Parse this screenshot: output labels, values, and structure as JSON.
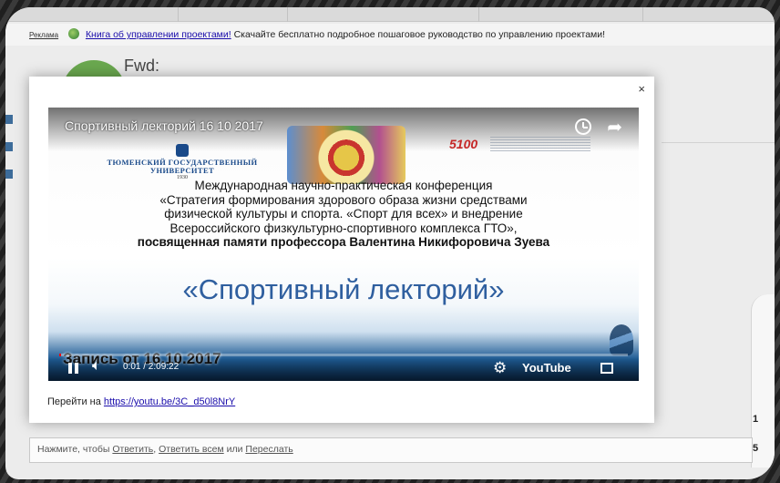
{
  "ad": {
    "tag": "Реклама",
    "link": "Книга об управлении проектами!",
    "text": " Скачайте бесплатно подробное пошаговое руководство по управлению проектами!"
  },
  "message": {
    "subject": "Fwd:"
  },
  "modal": {
    "close_label": "×",
    "goto_label": "Перейти на ",
    "goto_url": "https://youtu.be/3C_d50l8NrY"
  },
  "video": {
    "title": "Спортивный лекторий 16 10 2017",
    "university": "ТЮМЕНСКИЙ ГОСУДАРСТВЕННЫЙ УНИВЕРСИТЕТ",
    "university_year": "1930",
    "program_logo": "5100",
    "conference_line1": "Международная научно-практическая конференция",
    "conference_line2": "«Стратегия формирования здорового образа жизни средствами",
    "conference_line3": "физической культуры и спорта. «Спорт для всех» и внедрение",
    "conference_line4": "Всероссийского физкультурно-спортивного комплекса ГТО»,",
    "conference_line5": "посвященная памяти профессора Валентина Никифоровича Зуева",
    "big_title": "«Спортивный лекторий»",
    "caption": "Запись от 16.10.2017",
    "time": "0:01 / 2:09:22",
    "progress_percent": 0.1,
    "brand": "YouTube",
    "progress_color": "#ff0000"
  },
  "reply": {
    "prefix": "Нажмите, чтобы ",
    "reply_label": "Ответить",
    "sep1": ", ",
    "reply_all_label": "Ответить всем",
    "sep2": " или ",
    "forward_label": "Переслать"
  },
  "sidebar_counts": [
    "1",
    "5"
  ],
  "icons": [
    "close-icon",
    "clock-icon",
    "share-icon",
    "pause-icon",
    "volume-icon",
    "gear-icon",
    "fullscreen-icon"
  ]
}
